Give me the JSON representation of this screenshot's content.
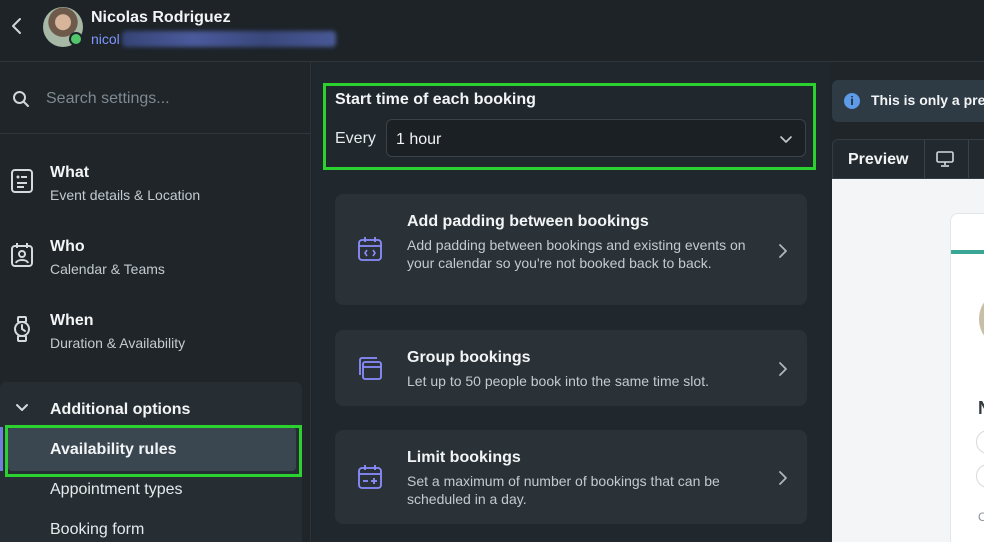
{
  "header": {
    "back_label": "back",
    "user_name": "Nicolas Rodriguez",
    "user_email_visible": "nicol"
  },
  "sidebar": {
    "search_placeholder": "Search settings...",
    "items": [
      {
        "title": "What",
        "subtitle": "Event details & Location",
        "icon": "document-list-icon"
      },
      {
        "title": "Who",
        "subtitle": "Calendar & Teams",
        "icon": "contact-calendar-icon"
      },
      {
        "title": "When",
        "subtitle": "Duration & Availability",
        "icon": "watch-icon"
      }
    ],
    "additional": {
      "title": "Additional options",
      "items": [
        "Availability rules",
        "Appointment types",
        "Booking form"
      ],
      "active_index": 0
    }
  },
  "main": {
    "start_time_label": "Start time of each booking",
    "every_label": "Every",
    "interval_value": "1 hour",
    "cards": [
      {
        "title": "Add padding between bookings",
        "description": "Add padding between bookings and existing events on your calendar so you're not booked back to back.",
        "icon": "calendar-code-icon"
      },
      {
        "title": "Group bookings",
        "description": "Let up to 50 people book into the same time slot.",
        "icon": "stacked-calendars-icon"
      },
      {
        "title": "Limit bookings",
        "description": "Set a maximum of number of bookings that can be scheduled in a day.",
        "icon": "calendar-minus-plus-icon"
      }
    ]
  },
  "preview": {
    "info_text": "This is only a prev",
    "title": "Preview",
    "card_initial": "N",
    "small_text": "C"
  },
  "colors": {
    "highlight": "#2bd12f",
    "accent_icon": "#8b8dff",
    "email": "#7f96ff"
  }
}
